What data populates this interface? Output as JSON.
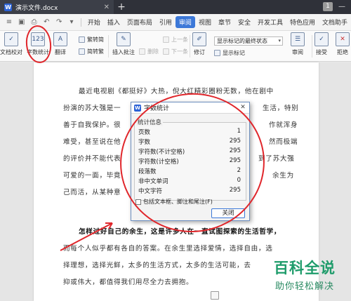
{
  "titlebar": {
    "doc_tab_title": "演示文件.docx",
    "doc_icon": "W",
    "window_counter": "1"
  },
  "menubar": {
    "items": [
      "开始",
      "插入",
      "页面布局",
      "引用",
      "审阅",
      "视图",
      "章节",
      "安全",
      "开发工具",
      "特色应用",
      "文档助手"
    ],
    "active": "审阅",
    "accent_color": "#3c78d8"
  },
  "ribbon": {
    "doc_proofread": "文档校对",
    "word_count": "字数统计",
    "translate": "翻译",
    "trad_to_simp": "繁转简",
    "simp_to_trad": "简转繁",
    "insert_comment": "插入批注",
    "delete": "删除",
    "prev": "上一条",
    "next": "下一条",
    "revise": "修订",
    "markup_view": "显示标记的最终状态",
    "show_markup": "显示标记",
    "review": "审阅",
    "accept": "接受",
    "reject": "拒绝"
  },
  "document": {
    "paragraphs": [
      "最近电视剧《都挺好》大热，倪大红精彩圈粉无数，他在剧中扮演的苏大强是一个特别作的老人，工作也不负责任，生活，特别善于自我保护。但退休后却在晚年作出了骑兵式的晚年无数，尽作就浑身难受，甚至说在他身上体现出了中国式家庭的多数问题，然而极端的评价并不能代表人们对他的全部认识，毕竟人们也看到了苏大强可爱的一面，毕竟他作为一个老人，也有自己对生活的安排和对余生为自己而活，从某种意义上来说，也算是一种启发。",
      "怎样过好自己的余生，这是许多人在一直试图探索的生活哲学，而每个人似乎都有各自的答案。在余生里选择爱情，选择自由，选择理想，选择光鲜，太多的生活方式，太多的生活可能，去活得伟大，都值得我们用尽全力去拥抱。"
    ],
    "lines": [
      "最近电视剧《都挺好》大热，倪大红精彩圈粉无数，他在剧中",
      "扮演的苏大强是一",
      "生活，特别",
      "善于自我保护。很",
      "作就浑身",
      "难受，甚至说在他",
      "然而极端",
      "的评价并不能代表",
      "到了苏大强",
      "可爱的一面，毕竟",
      "余生为",
      "己而活，从某种意",
      "怎样过好自己的余生，这是许多人在一直试图探索的生活哲学，",
      "而每个人似乎都有各自的答案。在余生里选择爱情，选择自由，选",
      "择理想，选择光鲜，太多的生活方式，太多的生活可能，去",
      "抑或伟大，都值得我们用尽全力去拥抱。"
    ]
  },
  "dialog": {
    "title": "字数统计",
    "group_label": "统计信息",
    "rows": [
      {
        "label": "页数",
        "value": "1"
      },
      {
        "label": "字数",
        "value": "295"
      },
      {
        "label": "字符数(不计空格)",
        "value": "295"
      },
      {
        "label": "字符数(计空格)",
        "value": "295"
      },
      {
        "label": "段落数",
        "value": "2"
      },
      {
        "label": "非中文单词",
        "value": "0"
      },
      {
        "label": "中文字符",
        "value": "295"
      }
    ],
    "checkbox_label": "包括文本框、脚注和尾注(F)",
    "close_button": "关闭"
  },
  "watermark": {
    "main": "百科全说",
    "sub": "助你轻松解决"
  },
  "colors": {
    "annotation_red": "#e0262b",
    "watermark_green": "#1f9c6b",
    "titlebar": "#2f3139"
  }
}
